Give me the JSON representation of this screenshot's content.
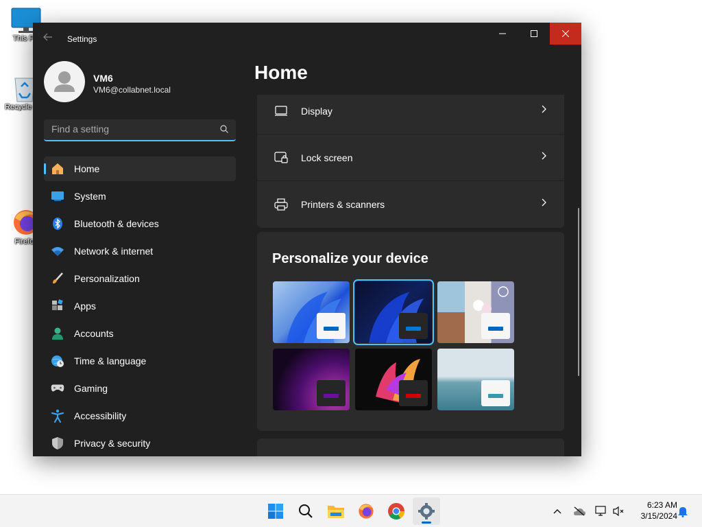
{
  "desktop": {
    "icons": [
      {
        "label": "This PC"
      },
      {
        "label": "Recycle Bin"
      },
      {
        "label": "Firefox"
      }
    ]
  },
  "window": {
    "title": "Settings",
    "accent_color": "#4cc2ff",
    "close_color": "#c42b1c"
  },
  "profile": {
    "name": "VM6",
    "email": "VM6@collabnet.local"
  },
  "search": {
    "placeholder": "Find a setting"
  },
  "nav": {
    "items": [
      {
        "label": "Home",
        "icon": "home-icon",
        "active": true
      },
      {
        "label": "System",
        "icon": "system-icon"
      },
      {
        "label": "Bluetooth & devices",
        "icon": "bluetooth-icon"
      },
      {
        "label": "Network & internet",
        "icon": "wifi-icon"
      },
      {
        "label": "Personalization",
        "icon": "brush-icon"
      },
      {
        "label": "Apps",
        "icon": "apps-icon"
      },
      {
        "label": "Accounts",
        "icon": "accounts-icon"
      },
      {
        "label": "Time & language",
        "icon": "globe-clock-icon"
      },
      {
        "label": "Gaming",
        "icon": "gamepad-icon"
      },
      {
        "label": "Accessibility",
        "icon": "accessibility-icon"
      },
      {
        "label": "Privacy & security",
        "icon": "shield-icon"
      }
    ]
  },
  "main": {
    "title": "Home",
    "rows": [
      {
        "label": "Display",
        "icon": "display-icon"
      },
      {
        "label": "Lock screen",
        "icon": "lock-screen-icon"
      },
      {
        "label": "Printers & scanners",
        "icon": "printer-icon"
      }
    ],
    "personalize": {
      "title": "Personalize your device",
      "themes": [
        {
          "name": "light-bloom",
          "selected": false,
          "accent": "#0067c0"
        },
        {
          "name": "dark-bloom",
          "selected": true,
          "accent": "#0078d4"
        },
        {
          "name": "spotlight",
          "selected": false,
          "accent": "#0067c0"
        },
        {
          "name": "glow",
          "selected": false,
          "accent": "#6b0f9c"
        },
        {
          "name": "captured-motion",
          "selected": false,
          "accent": "#d00000"
        },
        {
          "name": "flow",
          "selected": false,
          "accent": "#3a97b0"
        }
      ]
    }
  },
  "taskbar": {
    "apps": [
      "start-icon",
      "search-icon",
      "file-explorer-icon",
      "firefox-icon",
      "chrome-icon",
      "settings-icon"
    ],
    "time": "6:23 AM",
    "date": "3/15/2024"
  }
}
